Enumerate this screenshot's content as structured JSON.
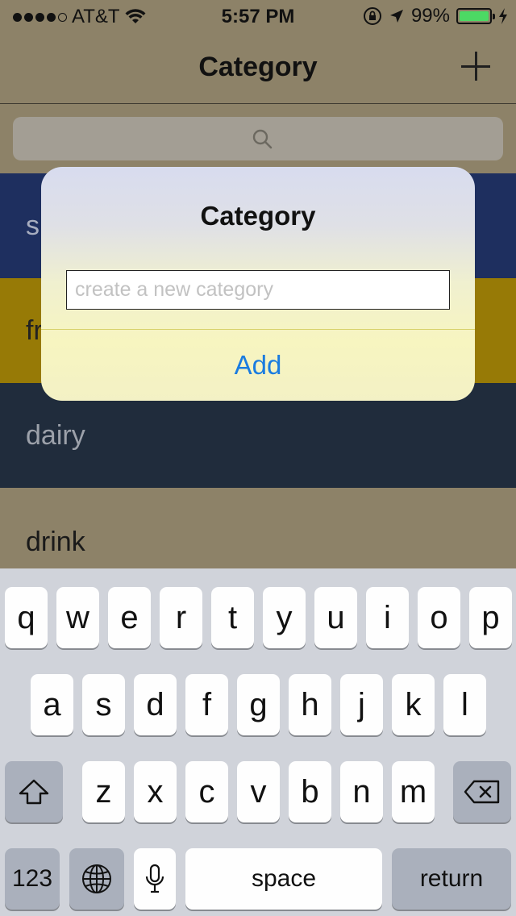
{
  "status_bar": {
    "carrier": "AT&T",
    "time": "5:57 PM",
    "battery_percent": "99%",
    "battery_level": 0.99,
    "signal_dots_filled": 4,
    "signal_dots_total": 5,
    "icons": [
      "wifi-icon",
      "orientation-lock-icon",
      "location-arrow-icon",
      "battery-icon",
      "charging-bolt-icon"
    ]
  },
  "nav": {
    "title": "Category",
    "add_icon": "plus-icon"
  },
  "search": {
    "icon": "search-icon",
    "placeholder": ""
  },
  "categories": [
    {
      "label": "s",
      "color": "#1e2f5f"
    },
    {
      "label": "fr",
      "color": "#977a06"
    },
    {
      "label": "dairy",
      "color": "#202c3c"
    },
    {
      "label": "drink",
      "color": "#8d8268"
    }
  ],
  "alert": {
    "title": "Category",
    "input_placeholder": "create a new category",
    "input_value": "",
    "add_label": "Add"
  },
  "keyboard": {
    "row1": [
      "q",
      "w",
      "e",
      "r",
      "t",
      "y",
      "u",
      "i",
      "o",
      "p"
    ],
    "row2": [
      "a",
      "s",
      "d",
      "f",
      "g",
      "h",
      "j",
      "k",
      "l"
    ],
    "row3": [
      "z",
      "x",
      "c",
      "v",
      "b",
      "n",
      "m"
    ],
    "numbers_label": "123",
    "space_label": "space",
    "return_label": "return",
    "shift_icon": "shift-icon",
    "delete_icon": "delete-icon",
    "globe_icon": "globe-icon",
    "mic_icon": "microphone-icon"
  },
  "colors": {
    "accent": "#1a7ce0",
    "nav_background": "#8d8268"
  }
}
